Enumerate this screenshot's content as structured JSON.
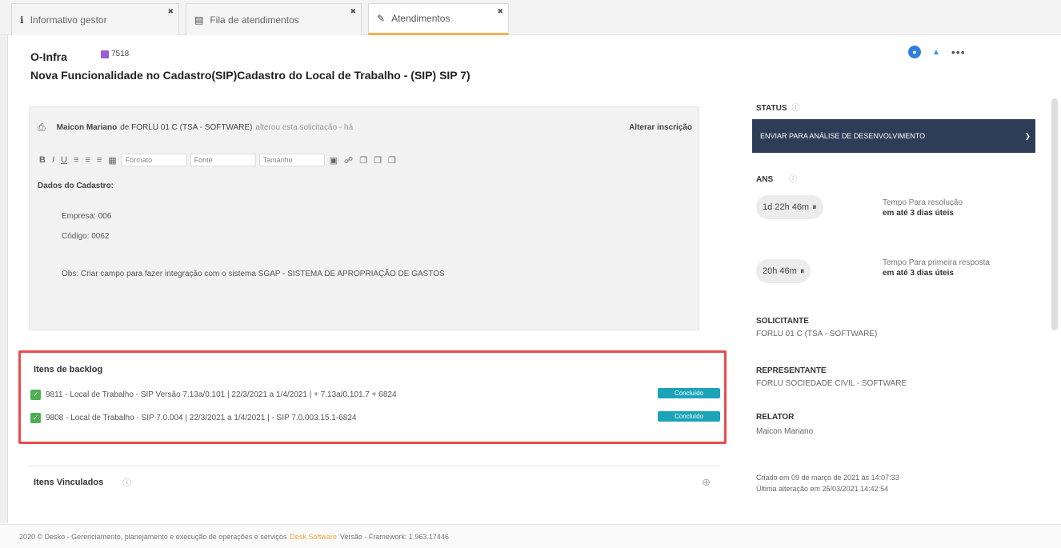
{
  "tabs": [
    {
      "icon": "info-icon",
      "label": "Informativo gestor"
    },
    {
      "icon": "queue-icon",
      "label": "Fila de atendimentos"
    },
    {
      "icon": "ticket-icon",
      "label": "Atendimentos"
    }
  ],
  "issue": {
    "key": "O-Infra",
    "tag": "7518",
    "title": "Nova Funcionalidade no Cadastro(SIP)Cadastro do Local de Trabalho - (SIP) SIP 7)"
  },
  "description": {
    "author": "Maicon Mariano",
    "company": "de FORLU 01 C (TSA - SOFTWARE)",
    "action": "alterou esta solicitação - há",
    "change_label": "Alterar inscrição",
    "toolbar": {
      "format": "Formato",
      "font": "Fonte",
      "size": "Tamanho"
    },
    "heading": "Dados do Cadastro:",
    "lines": [
      "Empresa: 006",
      "Código: 0062",
      "Obs: Criar campo para fazer integração com o sistema SGAP - SISTEMA DE APROPRIAÇÃO DE GASTOS"
    ]
  },
  "backlog": {
    "title": "Itens de backlog",
    "items": [
      {
        "text": "9811 - Local de Trabalho - SIP Versão 7.13a/0.101 | 22/3/2021 a 1/4/2021 | + 7.13a/0.101.7 + 6824",
        "status": "Concluído"
      },
      {
        "text": "9808 - Local de Trabalho - SIP 7.0.004 | 22/3/2021 a 1/4/2021 | - SIP 7.0.003.15.1-6824",
        "status": "Concluído"
      }
    ]
  },
  "linked": {
    "label": "Itens Vinculados"
  },
  "status": {
    "label": "STATUS",
    "value": "ENVIAR PARA ANÁLISE DE DESENVOLVIMENTO"
  },
  "ans": {
    "label": "ANS",
    "sla1": {
      "time": "1d 22h 46m",
      "desc": "Tempo Para resolução",
      "note": "em até 3 dias úteis"
    },
    "sla2": {
      "time": "20h 46m",
      "desc": "Tempo Para primeira resposta",
      "note": "em até 3 dias úteis"
    }
  },
  "requester": {
    "label": "SOLICITANTE",
    "value": "FORLU 01 C (TSA - SOFTWARE)"
  },
  "representative": {
    "label": "REPRESENTANTE",
    "value": "FORLU SOCIEDADE CIVIL - SOFTWARE"
  },
  "reporter": {
    "label": "RELATOR",
    "value": "Maicon Mariano"
  },
  "dates": {
    "created": "Criado em 09 de março de 2021 às 14:07:33",
    "updated": "Última alteração em 25/03/2021 14:42:54"
  },
  "footer": {
    "text": "2020 © Desko - Gerenciamento, planejamento e execução de operações e serviços",
    "brand": "Desk Software",
    "version": "Versão - Framework: 1.963.17446"
  }
}
